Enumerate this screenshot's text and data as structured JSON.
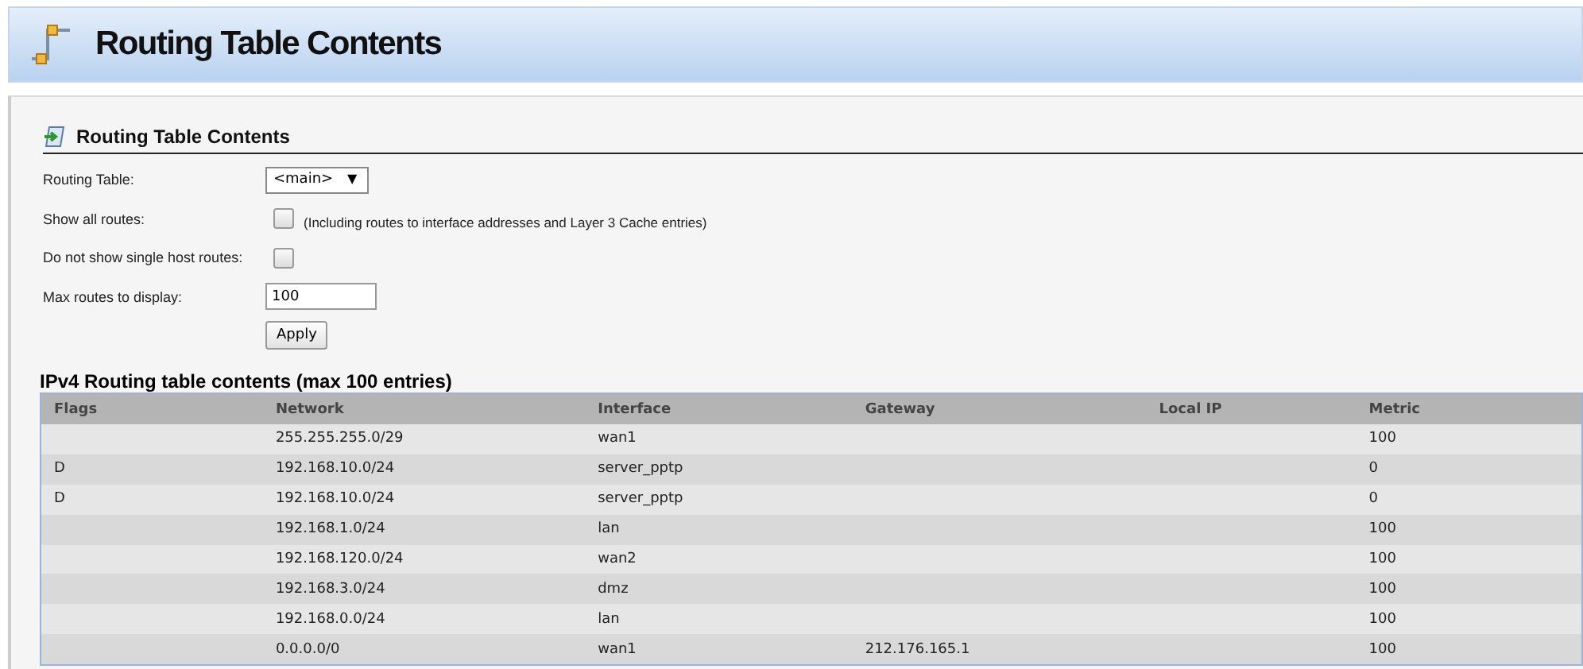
{
  "page_title": "Routing Table Contents",
  "section_title": "Routing Table Contents",
  "form": {
    "routing_table": {
      "label": "Routing Table:",
      "value": "<main>",
      "arrow": "▼"
    },
    "show_all_routes": {
      "label": "Show all routes:",
      "checked": false,
      "note": "(Including routes to interface addresses and Layer 3 Cache entries)"
    },
    "no_single_host": {
      "label": "Do not show single host routes:",
      "checked": false
    },
    "max_routes": {
      "label": "Max routes to display:",
      "value": "100"
    },
    "apply_button": "Apply"
  },
  "table": {
    "title": "IPv4 Routing table contents (max 100 entries)",
    "columns": [
      "Flags",
      "Network",
      "Interface",
      "Gateway",
      "Local IP",
      "Metric"
    ],
    "rows": [
      [
        "",
        "255.255.255.0/29",
        "wan1",
        "",
        "",
        "100"
      ],
      [
        "D",
        "192.168.10.0/24",
        "server_pptp",
        "",
        "",
        "0"
      ],
      [
        "D",
        "192.168.10.0/24",
        "server_pptp",
        "",
        "",
        "0"
      ],
      [
        "",
        "192.168.1.0/24",
        "lan",
        "",
        "",
        "100"
      ],
      [
        "",
        "192.168.120.0/24",
        "wan2",
        "",
        "",
        "100"
      ],
      [
        "",
        "192.168.3.0/24",
        "dmz",
        "",
        "",
        "100"
      ],
      [
        "",
        "192.168.0.0/24",
        "lan",
        "",
        "",
        "100"
      ],
      [
        "",
        "0.0.0.0/0",
        "wan1",
        "212.176.165.1",
        "",
        "100"
      ]
    ]
  }
}
